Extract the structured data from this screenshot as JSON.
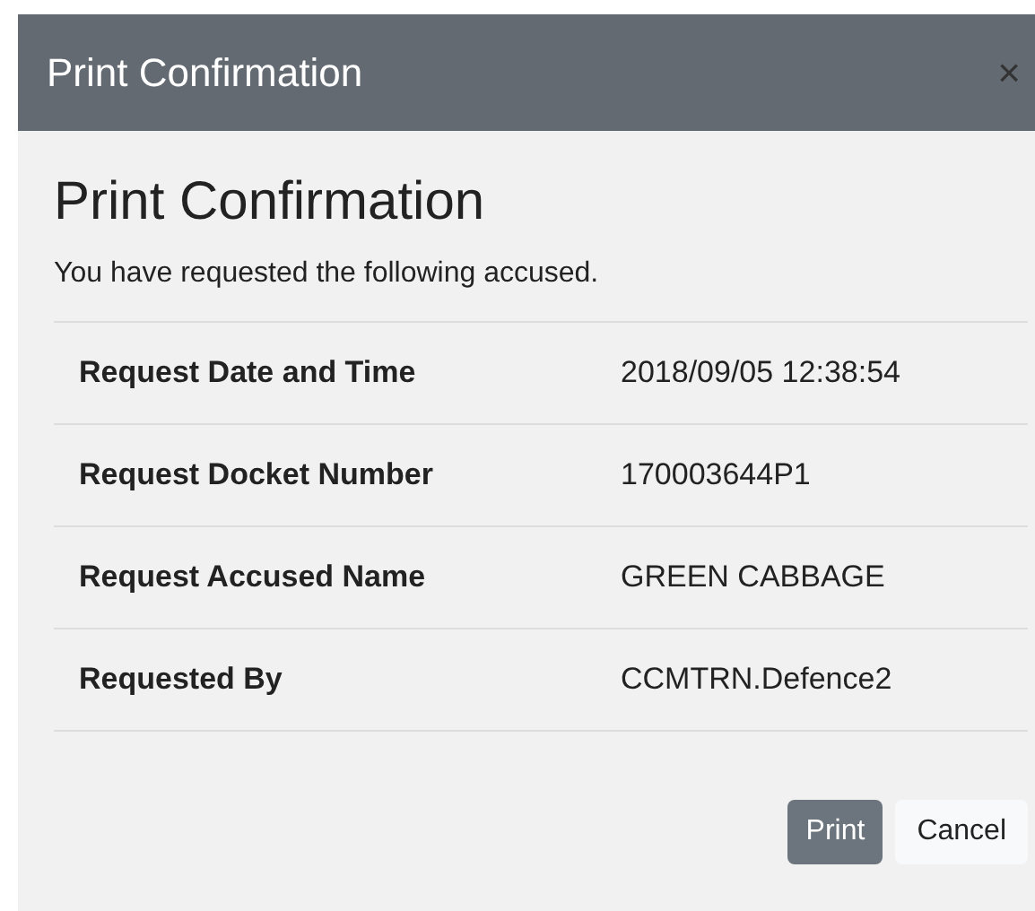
{
  "dialog": {
    "title": "Print Confirmation",
    "close": "×"
  },
  "heading": "Print Confirmation",
  "message": "You have requested the following accused.",
  "details": [
    {
      "label": "Request Date and Time",
      "value": "2018/09/05 12:38:54"
    },
    {
      "label": "Request Docket Number",
      "value": "170003644P1"
    },
    {
      "label": "Request Accused Name",
      "value": "GREEN CABBAGE"
    },
    {
      "label": "Requested By",
      "value": "CCMTRN.Defence2"
    }
  ],
  "buttons": [
    {
      "label": "Print",
      "kind": "primary"
    },
    {
      "label": "Cancel",
      "kind": "secondary"
    }
  ]
}
